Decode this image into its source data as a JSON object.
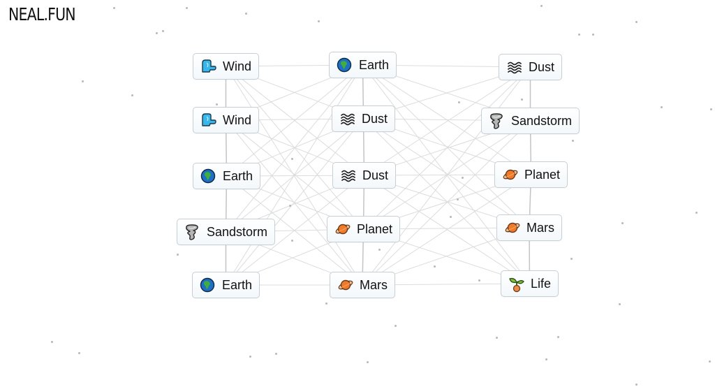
{
  "brand": {
    "logo_text": "NEAL.FUN"
  },
  "board": {
    "columns": [
      {
        "name": "left",
        "items": [
          {
            "label": "Wind",
            "icon": "wind-icon"
          },
          {
            "label": "Wind",
            "icon": "wind-icon"
          },
          {
            "label": "Earth",
            "icon": "earth-icon"
          },
          {
            "label": "Sandstorm",
            "icon": "sandstorm-icon"
          },
          {
            "label": "Earth",
            "icon": "earth-icon"
          }
        ]
      },
      {
        "name": "middle",
        "items": [
          {
            "label": "Earth",
            "icon": "earth-icon"
          },
          {
            "label": "Dust",
            "icon": "dust-icon"
          },
          {
            "label": "Dust",
            "icon": "dust-icon"
          },
          {
            "label": "Planet",
            "icon": "planet-icon"
          },
          {
            "label": "Mars",
            "icon": "planet-icon"
          }
        ]
      },
      {
        "name": "right",
        "items": [
          {
            "label": "Dust",
            "icon": "dust-icon"
          },
          {
            "label": "Sandstorm",
            "icon": "sandstorm-icon"
          },
          {
            "label": "Planet",
            "icon": "planet-icon"
          },
          {
            "label": "Mars",
            "icon": "planet-icon"
          },
          {
            "label": "Life",
            "icon": "sprout-icon"
          }
        ]
      }
    ]
  },
  "colors": {
    "line": "#dcdcdc",
    "column_line": "#c4c4c4",
    "node_border": "#c6ced6"
  }
}
